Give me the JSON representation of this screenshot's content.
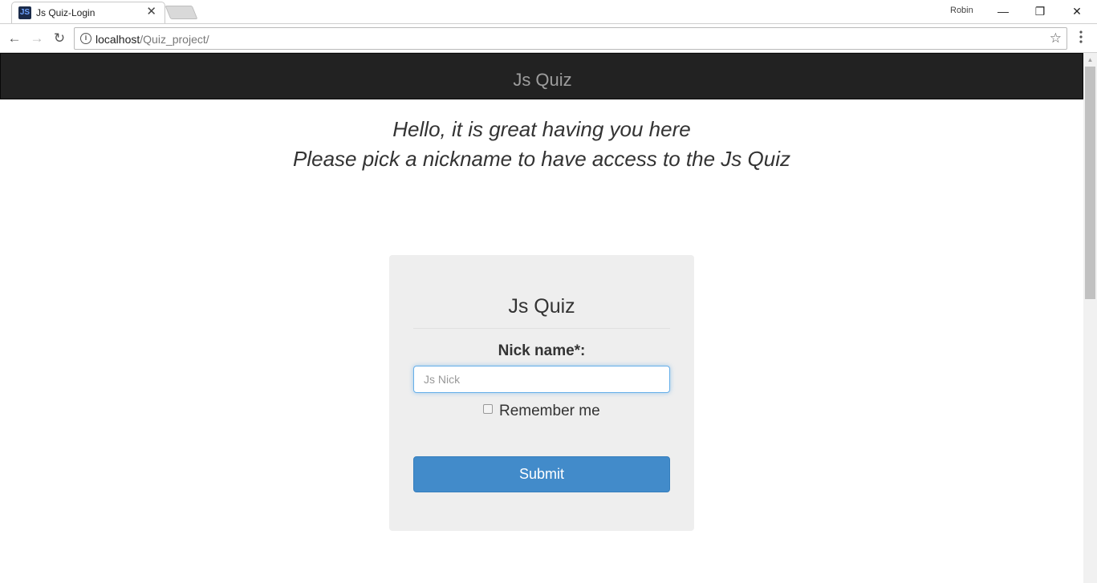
{
  "browser": {
    "tab_title": "Js Quiz-Login",
    "favicon_text": "JS",
    "close_glyph": "✕",
    "profile_name": "Robin",
    "url_host": "localhost",
    "url_path": "/Quiz_project/",
    "info_glyph": "i",
    "star_glyph": "☆",
    "back_glyph": "←",
    "forward_glyph": "→",
    "reload_glyph": "↻",
    "menu_glyph": "⋮",
    "min_glyph": "—",
    "max_glyph": "❐",
    "winclose_glyph": "✕"
  },
  "navbar": {
    "brand": "Js Quiz"
  },
  "greeting": {
    "line1": "Hello, it is great having you here",
    "line2": "Please pick a nickname to have access to the Js Quiz"
  },
  "login": {
    "title": "Js Quiz",
    "nick_label": "Nick name*:",
    "nick_placeholder": "Js Nick",
    "nick_value": "",
    "remember_label": "Remember me",
    "remember_checked": false,
    "submit_label": "Submit"
  },
  "colors": {
    "navbar_bg": "#222222",
    "brand_text": "#9d9d9d",
    "card_bg": "#eeeeee",
    "submit_bg": "#428bca",
    "input_focus_border": "#66afe9"
  }
}
